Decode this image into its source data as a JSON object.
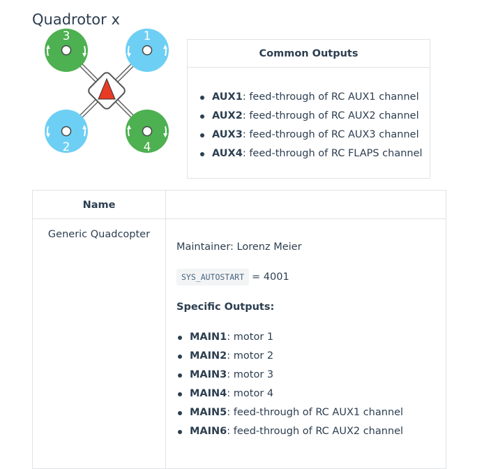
{
  "page": {
    "title": "Quadrotor x"
  },
  "diagram": {
    "motors": [
      {
        "label": "3",
        "color": "#4db051"
      },
      {
        "label": "1",
        "color": "#6ecff4"
      },
      {
        "label": "2",
        "color": "#6ecff4"
      },
      {
        "label": "4",
        "color": "#4db051"
      }
    ],
    "nose_color": "#e93a24"
  },
  "common_outputs": {
    "header": "Common Outputs",
    "items": [
      {
        "name": "AUX1",
        "desc": ": feed-through of RC AUX1 channel"
      },
      {
        "name": "AUX2",
        "desc": ": feed-through of RC AUX2 channel"
      },
      {
        "name": "AUX3",
        "desc": ": feed-through of RC AUX3 channel"
      },
      {
        "name": "AUX4",
        "desc": ": feed-through of RC FLAPS channel"
      }
    ]
  },
  "airframes_table": {
    "headers": [
      "Name",
      ""
    ],
    "rows": [
      {
        "name": "Generic Quadcopter",
        "maintainer": "Maintainer: Lorenz Meier",
        "param_code": "SYS_AUTOSTART",
        "param_value": "= 4001",
        "specific_heading": "Specific Outputs:",
        "outputs": [
          {
            "name": "MAIN1",
            "desc": ": motor 1"
          },
          {
            "name": "MAIN2",
            "desc": ": motor 2"
          },
          {
            "name": "MAIN3",
            "desc": ": motor 3"
          },
          {
            "name": "MAIN4",
            "desc": ": motor 4"
          },
          {
            "name": "MAIN5",
            "desc": ": feed-through of RC AUX1 channel"
          },
          {
            "name": "MAIN6",
            "desc": ": feed-through of RC AUX2 channel"
          }
        ]
      }
    ]
  }
}
